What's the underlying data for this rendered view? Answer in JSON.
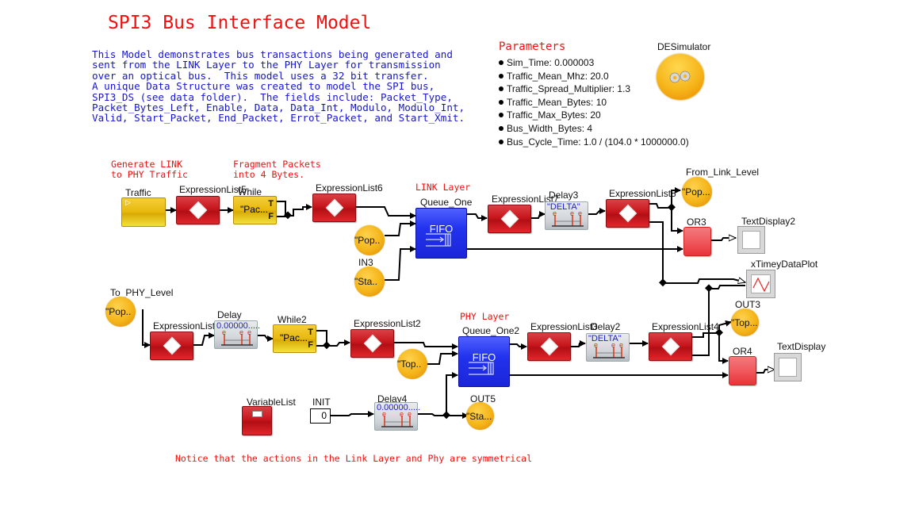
{
  "title": "SPI3 Bus Interface Model",
  "description": "This Model demonstrates bus transactions being generated and\nsent from the LINK Layer to the PHY Layer for transmission\nover an optical bus.  This model uses a 32 bit transfer.\nA unique Data Structure was created to model the SPI bus,\nSPI3_DS (see data folder).  The fields include: Packet_Type,\nPacket_Bytes_Left, Enable, Data, Data_Int, Modulo, Modulo_Int,\nValid, Start_Packet, End_Packet, Errot_Packet, and Start_Xmit.",
  "parameters": {
    "heading": "Parameters",
    "items": [
      "Sim_Time: 0.000003",
      "Traffic_Mean_Mhz: 20.0",
      "Traffic_Spread_Multiplier: 1.3",
      "Traffic_Mean_Bytes: 10",
      "Traffic_Max_Bytes: 20",
      "Bus_Width_Bytes: 4",
      "Bus_Cycle_Time: 1.0 / (104.0 * 1000000.0)"
    ]
  },
  "director": {
    "label": "DESimulator",
    "icon": "gears-icon"
  },
  "annotations": {
    "generate": "Generate LINK\nto PHY Traffic",
    "fragment": "Fragment Packets\ninto 4 Bytes.",
    "link_layer": "LINK Layer",
    "phy_layer": "PHY Layer",
    "notice": "Notice that the actions in the Link Layer and Phy are symmetrical"
  },
  "blocks": {
    "traffic": {
      "label": "Traffic"
    },
    "exprlist5": {
      "label": "ExpressionList5"
    },
    "while": {
      "label": "While",
      "text": "\"Pac...",
      "true_port": "T",
      "false_port": "F"
    },
    "exprlist6": {
      "label": "ExpressionList6"
    },
    "link_pop": {
      "text": "\"Pop.."
    },
    "in3": {
      "label": "IN3",
      "text": "\"Sta.."
    },
    "queue_one": {
      "label": "Queue_One",
      "text": "FIFO"
    },
    "exprlist7": {
      "label": "ExpressionList7"
    },
    "delay3": {
      "label": "Delay3",
      "value": "\"DELTA\""
    },
    "exprlist8": {
      "label": "ExpressionList8"
    },
    "from_link_level": {
      "label": "From_Link_Level",
      "text": "\"Pop..."
    },
    "or3": {
      "label": "OR3"
    },
    "textdisplay2": {
      "label": "TextDisplay2"
    },
    "xtimey": {
      "label": "xTimeyDataPlot"
    },
    "to_phy_level": {
      "label": "To_PHY_Level",
      "text": "\"Pop.."
    },
    "exprlist1": {
      "label": "ExpressionList1"
    },
    "delay": {
      "label": "Delay",
      "value": "0.00000....."
    },
    "while2": {
      "label": "While2",
      "text": "\"Pac...",
      "true_port": "T",
      "false_port": "F"
    },
    "exprlist2": {
      "label": "ExpressionList2"
    },
    "phy_top": {
      "text": "\"Top.."
    },
    "queue_one2": {
      "label": "Queue_One2",
      "text": "FIFO"
    },
    "exprlist3": {
      "label": "ExpressionList3"
    },
    "delay2": {
      "label": "Delay2",
      "value": "\"DELTA\""
    },
    "exprlist4": {
      "label": "ExpressionList4"
    },
    "out3": {
      "label": "OUT3",
      "text": "\"Top..."
    },
    "or4": {
      "label": "OR4"
    },
    "textdisplay": {
      "label": "TextDisplay"
    },
    "variablelist": {
      "label": "VariableList"
    },
    "init": {
      "label": "INIT",
      "value": "0"
    },
    "delay4": {
      "label": "Delay4",
      "value": "0.00000....."
    },
    "out5": {
      "label": "OUT5",
      "text": "\"Sta..."
    }
  },
  "colors": {
    "title": "#ee1111",
    "description": "#1515d0",
    "expression_block": "#c8161c",
    "queue_block": "#2233ee",
    "source_block": "#e8b80b",
    "or_block": "#f0595d",
    "delay_value": "#1a1ae0"
  }
}
